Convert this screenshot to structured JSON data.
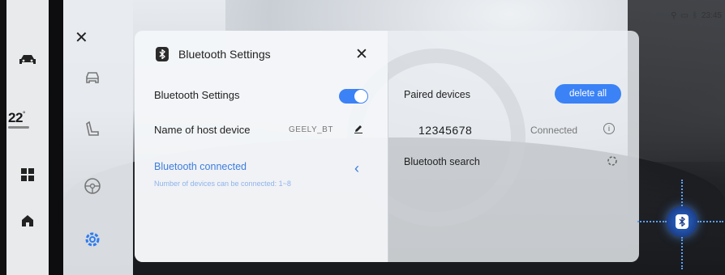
{
  "statusbar": {
    "time": "23:45",
    "icons": [
      "location-icon",
      "battery-icon",
      "bluetooth-icon"
    ]
  },
  "left_rail": {
    "temperature": "22",
    "temperature_unit": "°",
    "items": [
      "car-icon",
      "apps-grid-icon",
      "home-icon"
    ]
  },
  "settings_nav": {
    "close": "✕",
    "items": [
      "vehicle-settings-icon",
      "seat-icon",
      "steering-wheel-icon",
      "gear-icon"
    ],
    "active": "gear-icon"
  },
  "panel": {
    "title": "Bluetooth Settings",
    "close": "✕",
    "bluetooth_toggle_label": "Bluetooth Settings",
    "bluetooth_enabled": true,
    "host_name_label": "Name of host device",
    "host_name_value": "GEELY_BT",
    "bt_connected_label": "Bluetooth connected",
    "bt_connected_sub": "Number of devices can be connected: 1~8",
    "chevron": "‹",
    "paired_label": "Paired devices",
    "delete_all": "delete all",
    "device_name": "12345678",
    "device_status": "Connected",
    "device_info": "i",
    "search_label": "Bluetooth search"
  },
  "colors": {
    "accent": "#3b82f6",
    "link": "#3d7de0"
  }
}
